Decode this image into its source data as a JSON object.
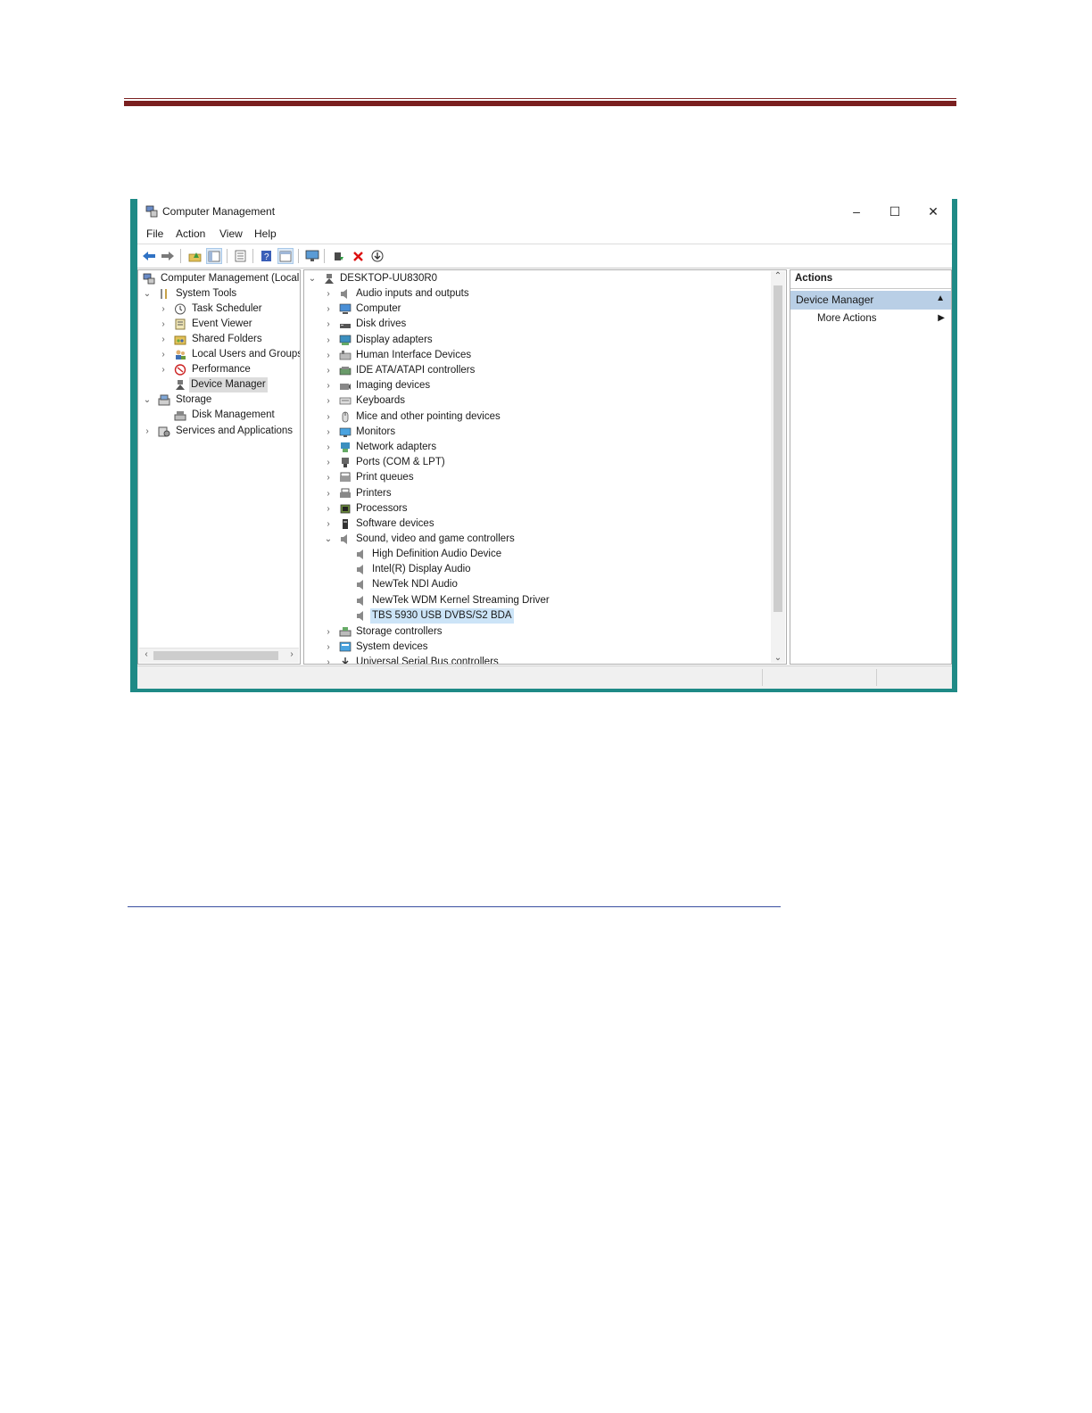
{
  "window": {
    "title": "Computer Management",
    "minimize_glyph": "–",
    "maximize_glyph": "☐",
    "close_glyph": "✕"
  },
  "menu": [
    "File",
    "Action",
    "View",
    "Help"
  ],
  "toolbar_icons": [
    "back-arrow-icon",
    "forward-arrow-icon",
    "up-folder-icon",
    "show-hide-tree-icon",
    "properties-icon",
    "help-icon",
    "show-action-pane-icon",
    "monitor-icon",
    "update-driver-icon",
    "uninstall-icon",
    "download-icon"
  ],
  "left_tree": {
    "root": "Computer Management (Local",
    "system_tools": "System Tools",
    "items": [
      "Task Scheduler",
      "Event Viewer",
      "Shared Folders",
      "Local Users and Groups",
      "Performance",
      "Device Manager"
    ],
    "storage": "Storage",
    "storage_items": [
      "Disk Management"
    ],
    "services": "Services and Applications"
  },
  "device_tree": {
    "root": "DESKTOP-UU830R0",
    "categories_top": [
      "Audio inputs and outputs",
      "Computer",
      "Disk drives",
      "Display adapters",
      "Human Interface Devices",
      "IDE ATA/ATAPI controllers",
      "Imaging devices",
      "Keyboards",
      "Mice and other pointing devices",
      "Monitors",
      "Network adapters",
      "Ports (COM & LPT)",
      "Print queues",
      "Printers",
      "Processors",
      "Software devices"
    ],
    "expanded": "Sound, video and game controllers",
    "children": [
      "High Definition Audio Device",
      "Intel(R) Display Audio",
      "NewTek NDI Audio",
      "NewTek WDM Kernel Streaming Driver",
      "TBS 5930 USB DVBS/S2 BDA"
    ],
    "categories_bottom": [
      "Storage controllers",
      "System devices",
      "Universal Serial Bus controllers"
    ]
  },
  "actions": {
    "header": "Actions",
    "section": "Device Manager",
    "more": "More Actions"
  },
  "colors": {
    "frame": "#1f8a86",
    "header_rule": "#7a1f1f",
    "footer_rule": "#3a4fa0",
    "action_section": "#b9cfe6"
  }
}
